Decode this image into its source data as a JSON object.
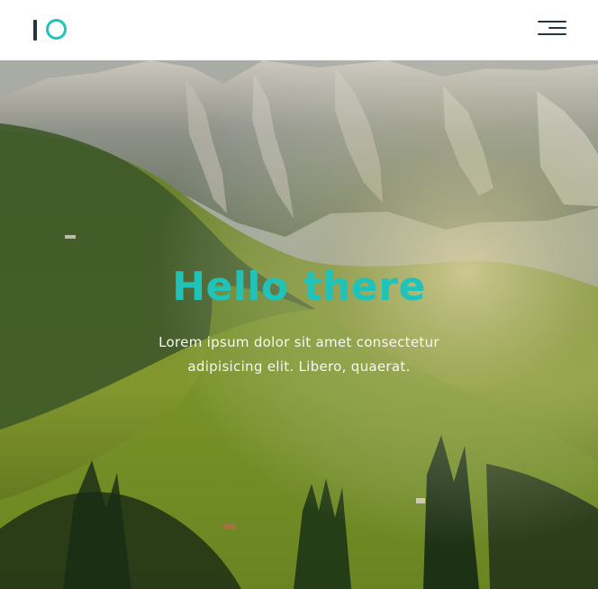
{
  "header": {
    "logo_label": "IO",
    "menu_label": "Menu"
  },
  "hero": {
    "title": "Hello there",
    "subtitle": "Lorem ipsum dolor sit amet consectetur adipisicing elit. Libero, quaerat."
  },
  "colors": {
    "accent": "#20c3b9",
    "text_dark": "#223744",
    "overlay_text": "#f7f8f2"
  },
  "icons": {
    "logo_mark": "logo-icon",
    "menu": "hamburger-menu-icon"
  }
}
